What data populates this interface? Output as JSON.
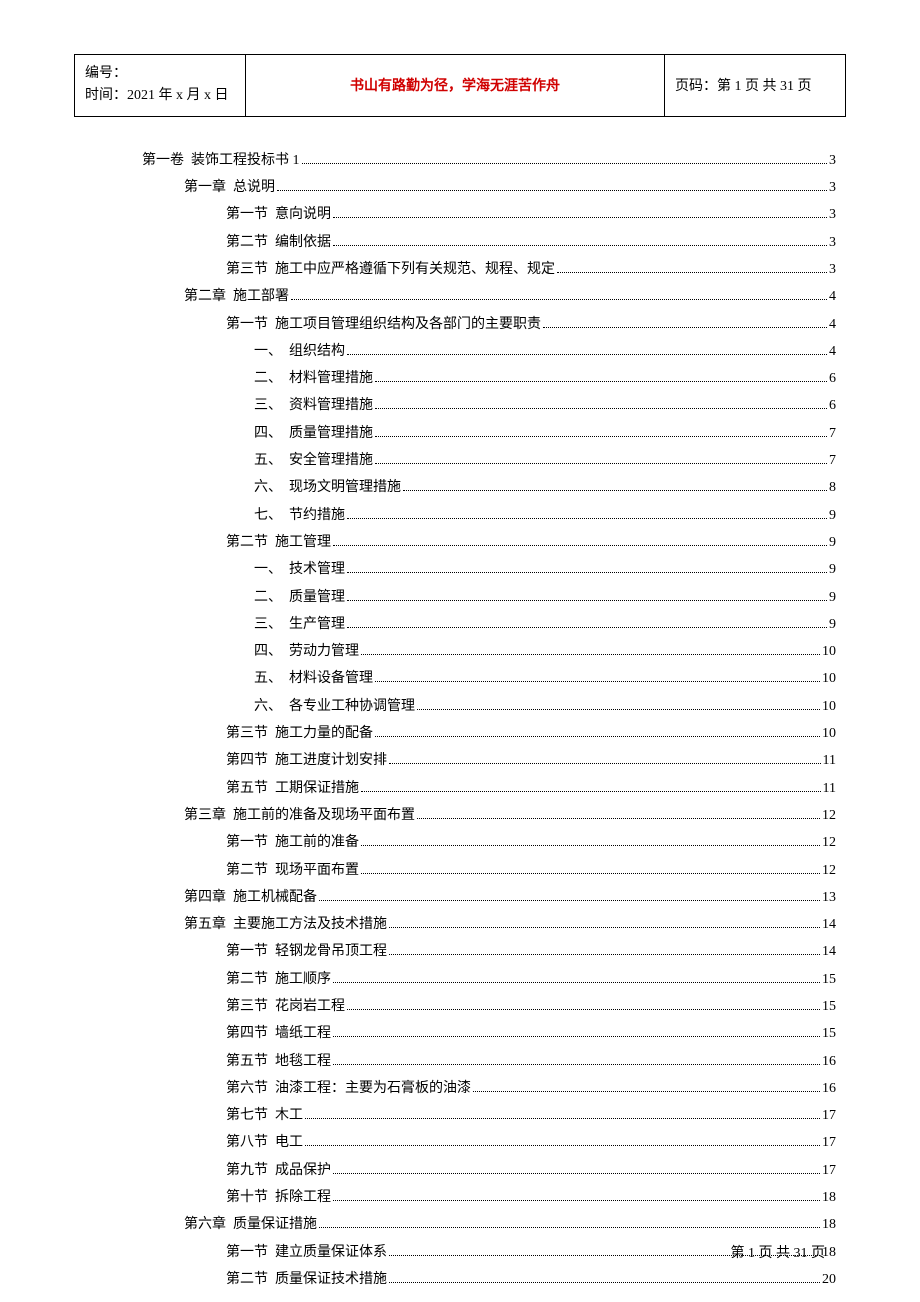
{
  "header": {
    "left_line1": "编号：",
    "left_line2": "时间：2021 年 x 月 x 日",
    "center": "书山有路勤为径，学海无涯苦作舟",
    "right": "页码：第 1 页 共 31 页"
  },
  "toc": [
    {
      "indent": 0,
      "label": "第一卷  装饰工程投标书 1",
      "page": "3"
    },
    {
      "indent": 1,
      "label": "第一章  总说明",
      "page": "3"
    },
    {
      "indent": 2,
      "label": "第一节  意向说明",
      "page": "3"
    },
    {
      "indent": 2,
      "label": "第二节  编制依据",
      "page": "3"
    },
    {
      "indent": 2,
      "label": "第三节  施工中应严格遵循下列有关规范、规程、规定",
      "page": "3"
    },
    {
      "indent": 1,
      "label": "第二章  施工部署",
      "page": "4"
    },
    {
      "indent": 2,
      "label": "第一节  施工项目管理组织结构及各部门的主要职责",
      "page": "4"
    },
    {
      "indent": 3,
      "label": "一、  组织结构",
      "page": "4"
    },
    {
      "indent": 3,
      "label": "二、  材料管理措施",
      "page": "6"
    },
    {
      "indent": 3,
      "label": "三、  资料管理措施",
      "page": "6"
    },
    {
      "indent": 3,
      "label": "四、  质量管理措施",
      "page": "7"
    },
    {
      "indent": 3,
      "label": "五、  安全管理措施",
      "page": "7"
    },
    {
      "indent": 3,
      "label": "六、  现场文明管理措施",
      "page": "8"
    },
    {
      "indent": 3,
      "label": "七、  节约措施",
      "page": "9"
    },
    {
      "indent": 2,
      "label": "第二节  施工管理",
      "page": "9"
    },
    {
      "indent": 3,
      "label": "一、  技术管理",
      "page": "9"
    },
    {
      "indent": 3,
      "label": "二、  质量管理",
      "page": "9"
    },
    {
      "indent": 3,
      "label": "三、  生产管理",
      "page": "9"
    },
    {
      "indent": 3,
      "label": "四、  劳动力管理",
      "page": "10"
    },
    {
      "indent": 3,
      "label": "五、  材料设备管理",
      "page": "10"
    },
    {
      "indent": 3,
      "label": "六、  各专业工种协调管理",
      "page": "10"
    },
    {
      "indent": 2,
      "label": "第三节  施工力量的配备",
      "page": "10"
    },
    {
      "indent": 2,
      "label": "第四节  施工进度计划安排",
      "page": "11"
    },
    {
      "indent": 2,
      "label": "第五节  工期保证措施",
      "page": "11"
    },
    {
      "indent": 1,
      "label": "第三章  施工前的准备及现场平面布置",
      "page": "12"
    },
    {
      "indent": 2,
      "label": "第一节  施工前的准备",
      "page": "12"
    },
    {
      "indent": 2,
      "label": "第二节  现场平面布置",
      "page": "12"
    },
    {
      "indent": 1,
      "label": "第四章  施工机械配备",
      "page": "13"
    },
    {
      "indent": 1,
      "label": "第五章  主要施工方法及技术措施",
      "page": "14"
    },
    {
      "indent": 2,
      "label": "第一节  轻钢龙骨吊顶工程",
      "page": "14"
    },
    {
      "indent": 2,
      "label": "第二节  施工顺序",
      "page": "15"
    },
    {
      "indent": 2,
      "label": "第三节  花岗岩工程",
      "page": "15"
    },
    {
      "indent": 2,
      "label": "第四节  墙纸工程",
      "page": "15"
    },
    {
      "indent": 2,
      "label": "第五节  地毯工程",
      "page": "16"
    },
    {
      "indent": 2,
      "label": "第六节  油漆工程：主要为石膏板的油漆",
      "page": "16"
    },
    {
      "indent": 2,
      "label": "第七节  木工",
      "page": "17"
    },
    {
      "indent": 2,
      "label": "第八节  电工",
      "page": "17"
    },
    {
      "indent": 2,
      "label": "第九节  成品保护",
      "page": "17"
    },
    {
      "indent": 2,
      "label": "第十节  拆除工程",
      "page": "18"
    },
    {
      "indent": 1,
      "label": "第六章  质量保证措施",
      "page": "18"
    },
    {
      "indent": 2,
      "label": "第一节  建立质量保证体系",
      "page": "18"
    },
    {
      "indent": 2,
      "label": "第二节  质量保证技术措施",
      "page": "20"
    }
  ],
  "footer": "第 1 页 共 31 页"
}
